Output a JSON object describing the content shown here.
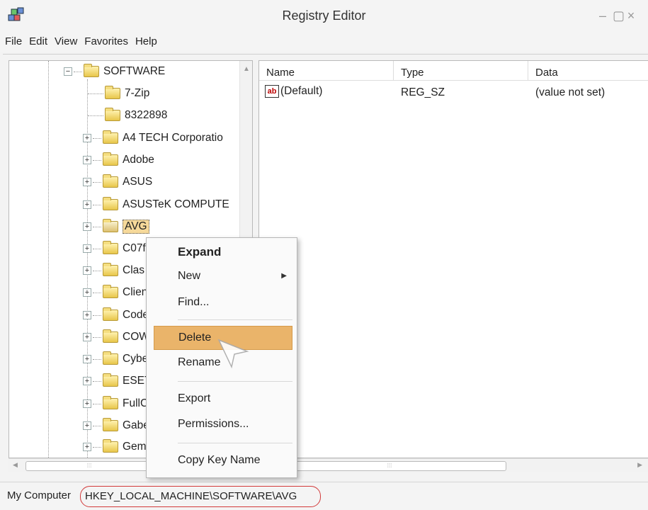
{
  "window": {
    "title": "Registry Editor",
    "app_icon": "registry-cubes-icon",
    "controls": {
      "minimize": "–",
      "maximize": "▢",
      "close": "×"
    }
  },
  "menubar": [
    "File",
    "Edit",
    "View",
    "Favorites",
    "Help"
  ],
  "tree": {
    "root": "SOFTWARE",
    "items": [
      {
        "label": "7-Zip",
        "expandable": false
      },
      {
        "label": "8322898",
        "expandable": false
      },
      {
        "label": "A4 TECH Corporatio",
        "expandable": true
      },
      {
        "label": "Adobe",
        "expandable": true
      },
      {
        "label": "ASUS",
        "expandable": true
      },
      {
        "label": "ASUSTeK COMPUTE",
        "expandable": true
      },
      {
        "label": "AVG",
        "expandable": true,
        "selected": true
      },
      {
        "label": "C07f",
        "expandable": true
      },
      {
        "label": "Clas",
        "expandable": true
      },
      {
        "label": "Clien",
        "expandable": true
      },
      {
        "label": "Code",
        "expandable": true
      },
      {
        "label": "COW",
        "expandable": true
      },
      {
        "label": "Cybe",
        "expandable": true
      },
      {
        "label": "ESET",
        "expandable": true
      },
      {
        "label": "FullC",
        "expandable": true
      },
      {
        "label": "Gabe",
        "expandable": true
      },
      {
        "label": "Gem",
        "expandable": true
      }
    ]
  },
  "list": {
    "columns": [
      "Name",
      "Type",
      "Data"
    ],
    "rows": [
      {
        "icon": "ab",
        "name": "(Default)",
        "type": "REG_SZ",
        "data": "(value not set)"
      }
    ]
  },
  "context_menu": {
    "items": [
      "Expand",
      "New",
      "Find...",
      "Delete",
      "Rename",
      "Export",
      "Permissions...",
      "Copy Key Name"
    ],
    "highlighted": "Delete",
    "default_item": "Expand"
  },
  "statusbar": {
    "label": "My Computer",
    "path": "HKEY_LOCAL_MACHINE\\SOFTWARE\\AVG",
    "highlight_color": "#d23a3a"
  },
  "colors": {
    "highlight": "#eab46a",
    "folder": "#e8c64a"
  }
}
